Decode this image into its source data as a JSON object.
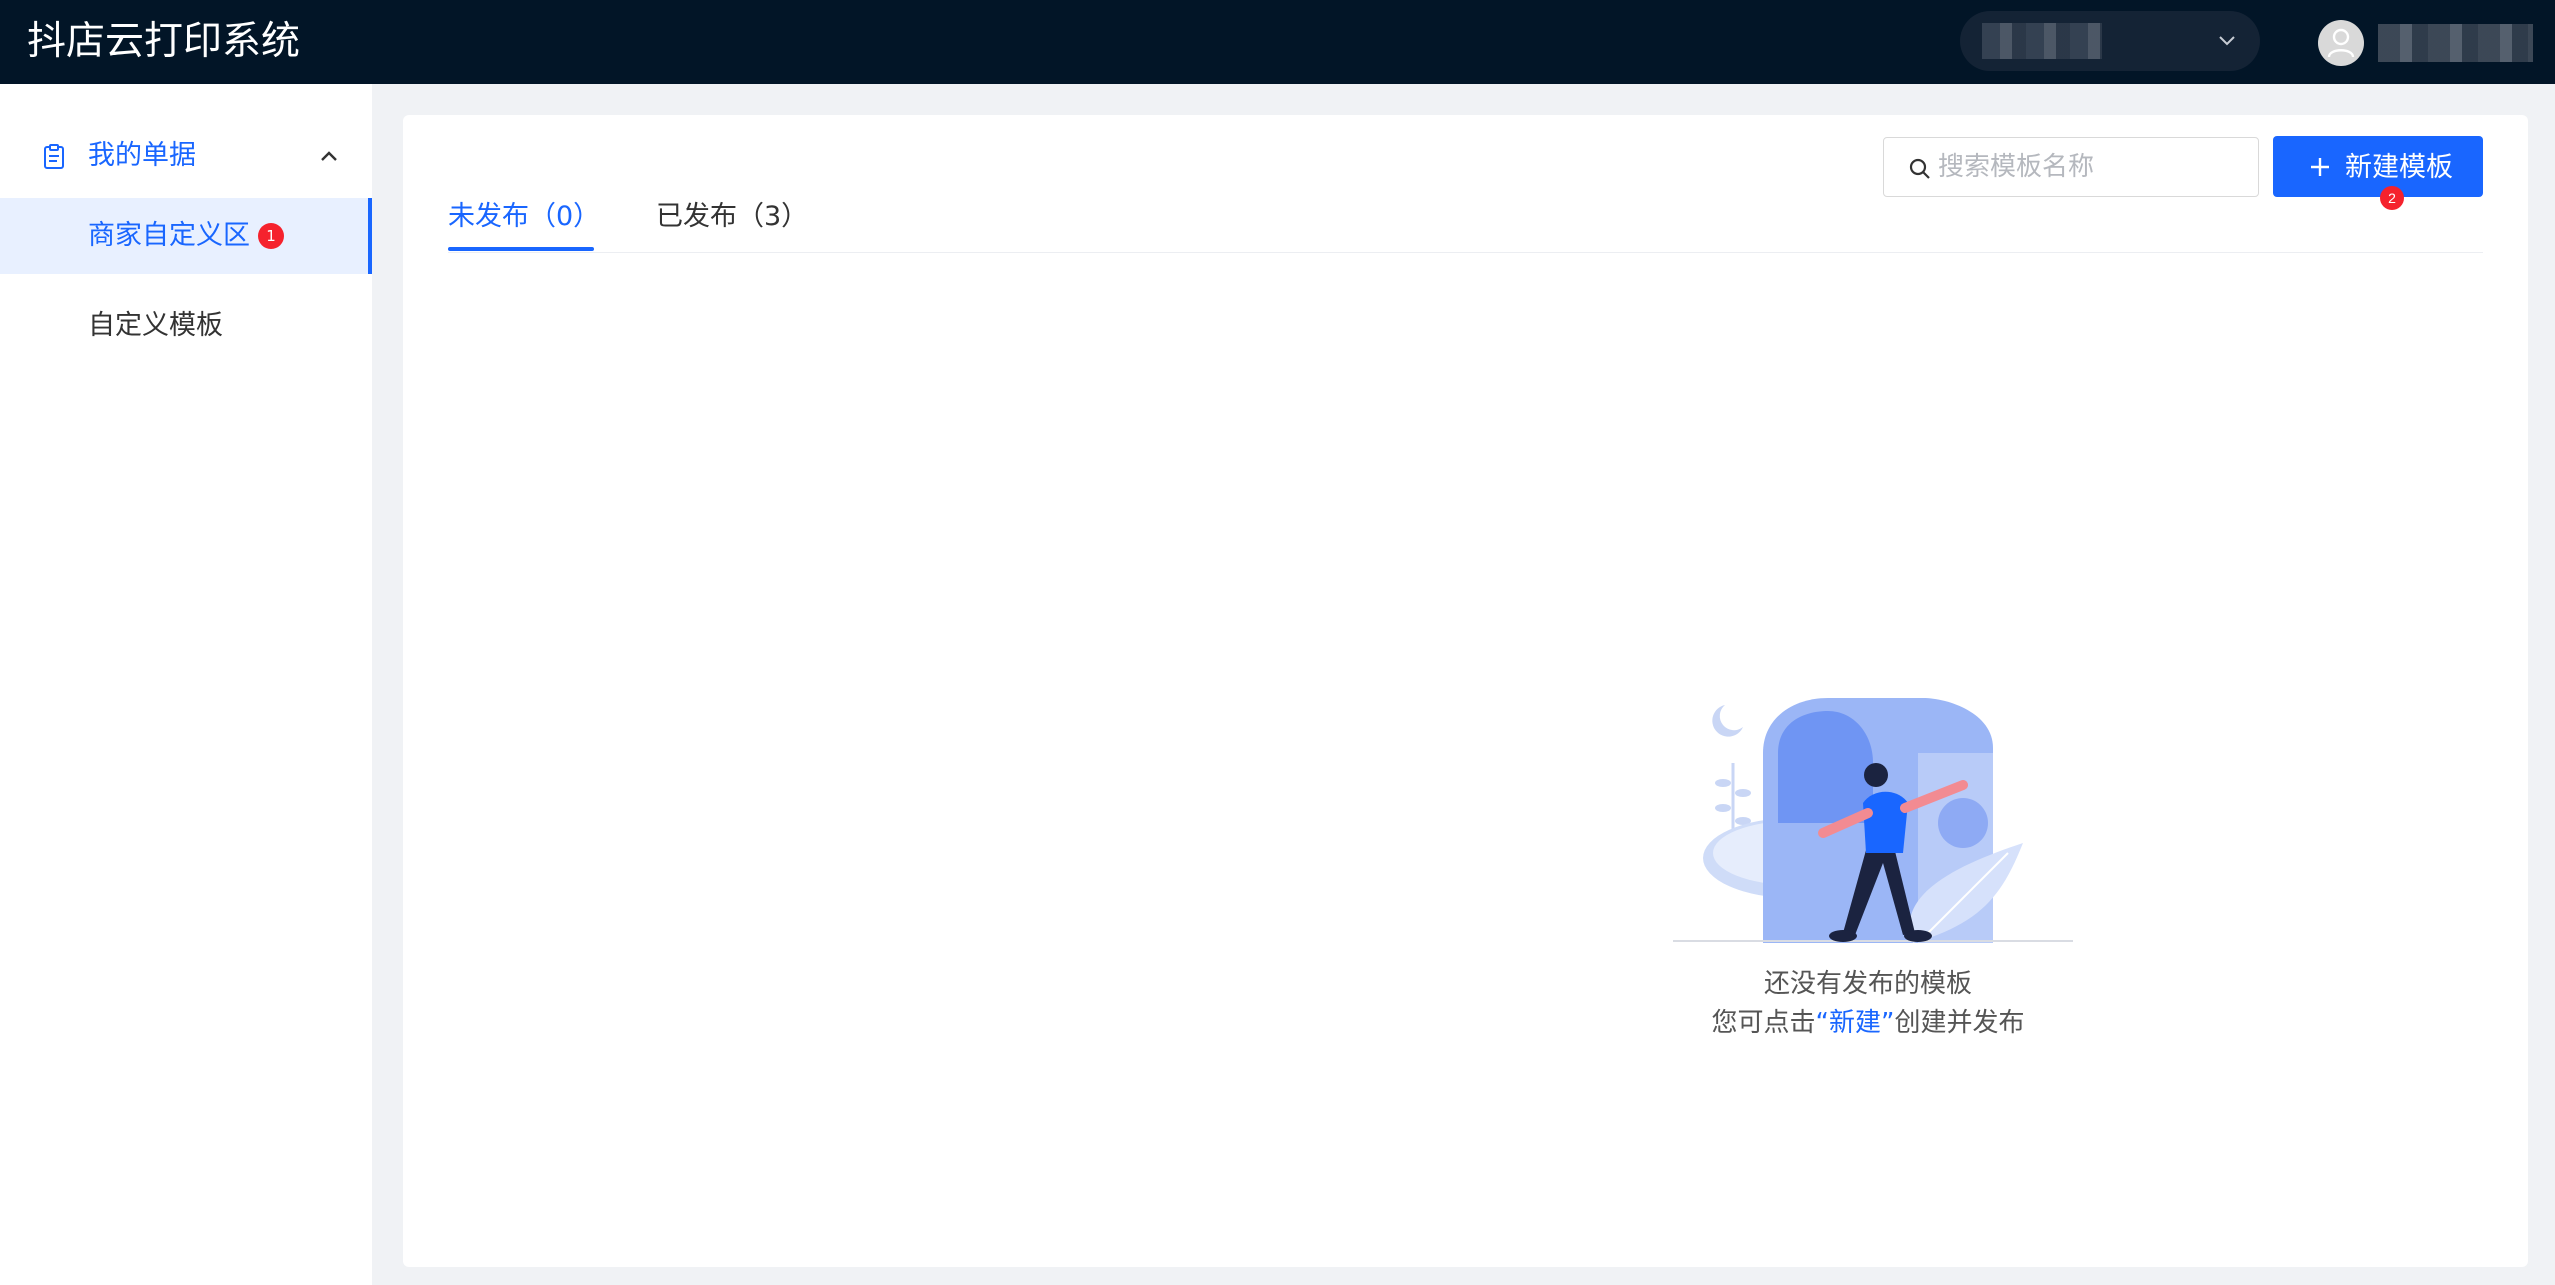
{
  "header": {
    "app_title": "抖店云打印系统",
    "shop_select_icon": "chevron-down-icon",
    "avatar_icon": "user-icon"
  },
  "sidebar": {
    "group": {
      "label": "我的单据",
      "icon": "document-icon",
      "toggle_icon": "chevron-up-icon"
    },
    "items": [
      {
        "label": "商家自定义区",
        "badge": "1",
        "active": true
      },
      {
        "label": "自定义模板",
        "active": false
      }
    ]
  },
  "main": {
    "tabs": [
      {
        "label": "未发布（0）",
        "active": true
      },
      {
        "label": "已发布（3）",
        "active": false
      }
    ],
    "search": {
      "placeholder": "搜索模板名称",
      "value": "",
      "icon": "search-icon"
    },
    "new_button": {
      "label": "新建模板",
      "icon": "plus-icon",
      "badge": "2"
    },
    "empty_state": {
      "line1": "还没有发布的模板",
      "line2_prefix": "您可点击",
      "line2_link": "“新建”",
      "line2_suffix": "创建并发布"
    }
  },
  "colors": {
    "header_bg": "#021527",
    "primary": "#1966ff",
    "badge": "#f5222d",
    "page_bg": "#f0f2f5"
  }
}
